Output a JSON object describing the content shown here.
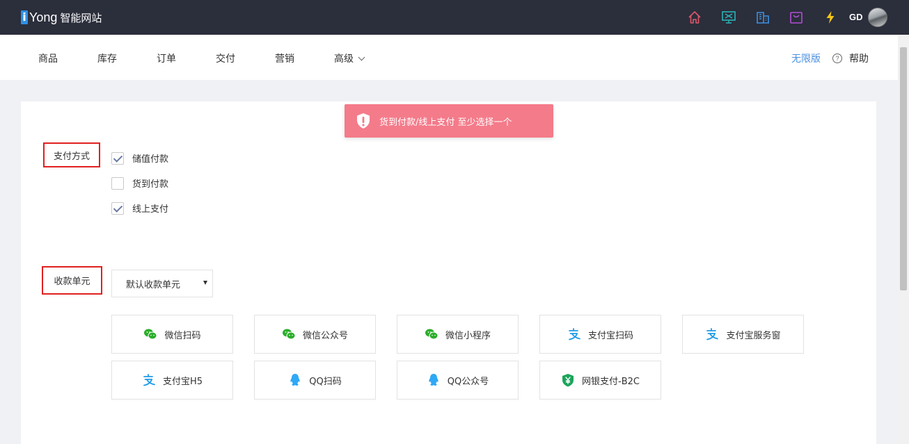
{
  "header": {
    "logo_mark": "i",
    "logo_brand": "Yong",
    "logo_subtitle": "智能网站",
    "icons": [
      "home-icon",
      "monitor-icon",
      "building-icon",
      "shopping-bag-icon",
      "lightning-icon"
    ],
    "user_initials": "GD"
  },
  "nav": {
    "items": [
      "商品",
      "库存",
      "订单",
      "交付",
      "营销",
      "高级"
    ],
    "edition_link": "无限版",
    "help_label": "帮助",
    "help_icon_glyph": "?"
  },
  "toast": {
    "message": "货到付款/线上支付 至少选择一个",
    "icon": "shield-exclamation-icon"
  },
  "payment_method": {
    "label": "支付方式",
    "options": [
      {
        "label": "储值付款",
        "checked": true
      },
      {
        "label": "货到付款",
        "checked": false
      },
      {
        "label": "线上支付",
        "checked": true
      }
    ]
  },
  "collection_unit": {
    "label": "收款单元",
    "selected": "默认收款单元"
  },
  "channels": [
    {
      "label": "微信扫码",
      "icon": "wechat-icon"
    },
    {
      "label": "微信公众号",
      "icon": "wechat-icon"
    },
    {
      "label": "微信小程序",
      "icon": "wechat-icon"
    },
    {
      "label": "支付宝扫码",
      "icon": "alipay-icon"
    },
    {
      "label": "支付宝服务窗",
      "icon": "alipay-icon"
    },
    {
      "label": "支付宝H5",
      "icon": "alipay-icon"
    },
    {
      "label": "QQ扫码",
      "icon": "qq-icon"
    },
    {
      "label": "QQ公众号",
      "icon": "qq-icon"
    },
    {
      "label": "网银支付-B2C",
      "icon": "unionpay-shield-icon"
    }
  ],
  "colors": {
    "topbar": "#2b2e3b",
    "toast": "#f47b8a",
    "link": "#4a90e2",
    "highlight_box": "#e02020",
    "wechat": "#2aae2a",
    "alipay": "#1e9be8",
    "qq": "#2fa8f5",
    "unionpay": "#1aa55a"
  }
}
